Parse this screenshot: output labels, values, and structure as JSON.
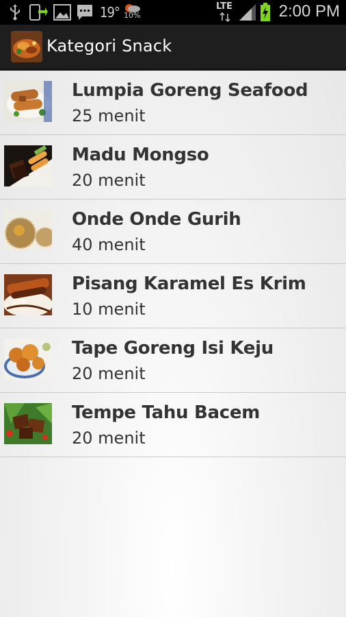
{
  "status_bar": {
    "temperature": "19°",
    "weather_percent": "10%",
    "network": "LTE",
    "time": "2:00 PM",
    "icons": [
      "usb-icon",
      "phone-sync-icon",
      "image-icon",
      "message-icon",
      "weather-icon",
      "signal-icon",
      "battery-charging-icon"
    ]
  },
  "action_bar": {
    "title": "Kategori Snack",
    "icon": "app-food-icon"
  },
  "items": [
    {
      "title": "Lumpia Goreng Seafood",
      "duration": "25 menit"
    },
    {
      "title": "Madu Mongso",
      "duration": "20 menit"
    },
    {
      "title": "Onde Onde Gurih",
      "duration": "40 menit"
    },
    {
      "title": "Pisang Karamel Es Krim",
      "duration": "10 menit"
    },
    {
      "title": "Tape Goreng Isi Keju",
      "duration": "20 menit"
    },
    {
      "title": "Tempe Tahu Bacem",
      "duration": "20 menit"
    }
  ],
  "colors": {
    "status_bar_bg": "#000000",
    "action_bar_bg": "#1e1e1e",
    "text": "#333333",
    "battery": "#7fd321"
  }
}
